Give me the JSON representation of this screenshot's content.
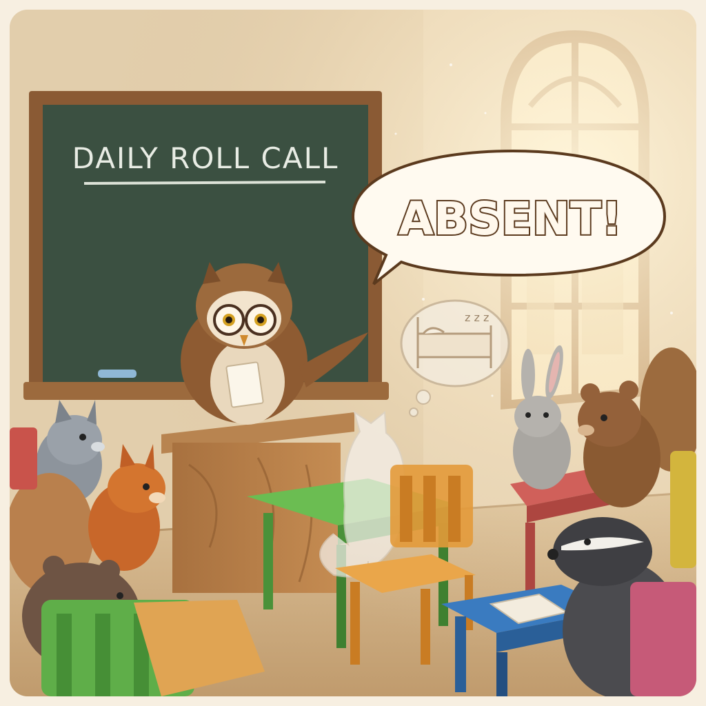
{
  "scene": {
    "blackboard_text": "DAILY ROLL CALL",
    "speech_bubble_text": "ABSENT!",
    "dream_text": "z z z"
  },
  "colors": {
    "wall": "#e6d2b2",
    "board": "#3f5444",
    "board_frame": "#8a5a34",
    "window_light": "#fff3cf",
    "floor": "#cfae84",
    "desk_green": "#5aa344",
    "desk_blue": "#2f6fb0",
    "desk_red": "#c9534b",
    "chair_orange": "#e39a3a",
    "chair_green": "#5fae49",
    "chair_pink": "#c65a78",
    "bubble_stroke": "#5b3a1e"
  }
}
